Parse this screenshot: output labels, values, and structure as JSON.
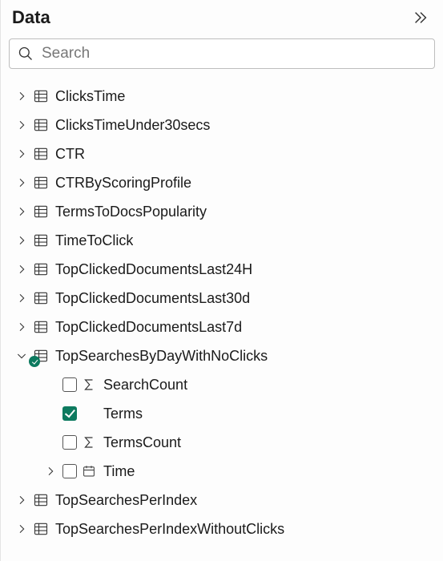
{
  "header": {
    "title": "Data",
    "collapse_icon": "double-chevron-right"
  },
  "search": {
    "placeholder": "Search",
    "value": ""
  },
  "tree": [
    {
      "label": "ClicksTime",
      "icon": "table",
      "expanded": false
    },
    {
      "label": "ClicksTimeUnder30secs",
      "icon": "table",
      "expanded": false
    },
    {
      "label": "CTR",
      "icon": "table",
      "expanded": false
    },
    {
      "label": "CTRByScoringProfile",
      "icon": "table",
      "expanded": false
    },
    {
      "label": "TermsToDocsPopularity",
      "icon": "table",
      "expanded": false
    },
    {
      "label": "TimeToClick",
      "icon": "table",
      "expanded": false
    },
    {
      "label": "TopClickedDocumentsLast24H",
      "icon": "table",
      "expanded": false
    },
    {
      "label": "TopClickedDocumentsLast30d",
      "icon": "table",
      "expanded": false
    },
    {
      "label": "TopClickedDocumentsLast7d",
      "icon": "table",
      "expanded": false
    },
    {
      "label": "TopSearchesByDayWithNoClicks",
      "icon": "table",
      "expanded": true,
      "badge": true,
      "children": [
        {
          "label": "SearchCount",
          "checked": false,
          "icon": "sigma"
        },
        {
          "label": "Terms",
          "checked": true,
          "icon": null
        },
        {
          "label": "TermsCount",
          "checked": false,
          "icon": "sigma"
        },
        {
          "label": "Time",
          "checked": false,
          "icon": "date",
          "expandable": true
        }
      ]
    },
    {
      "label": "TopSearchesPerIndex",
      "icon": "table",
      "expanded": false
    },
    {
      "label": "TopSearchesPerIndexWithoutClicks",
      "icon": "table",
      "expanded": false
    }
  ]
}
